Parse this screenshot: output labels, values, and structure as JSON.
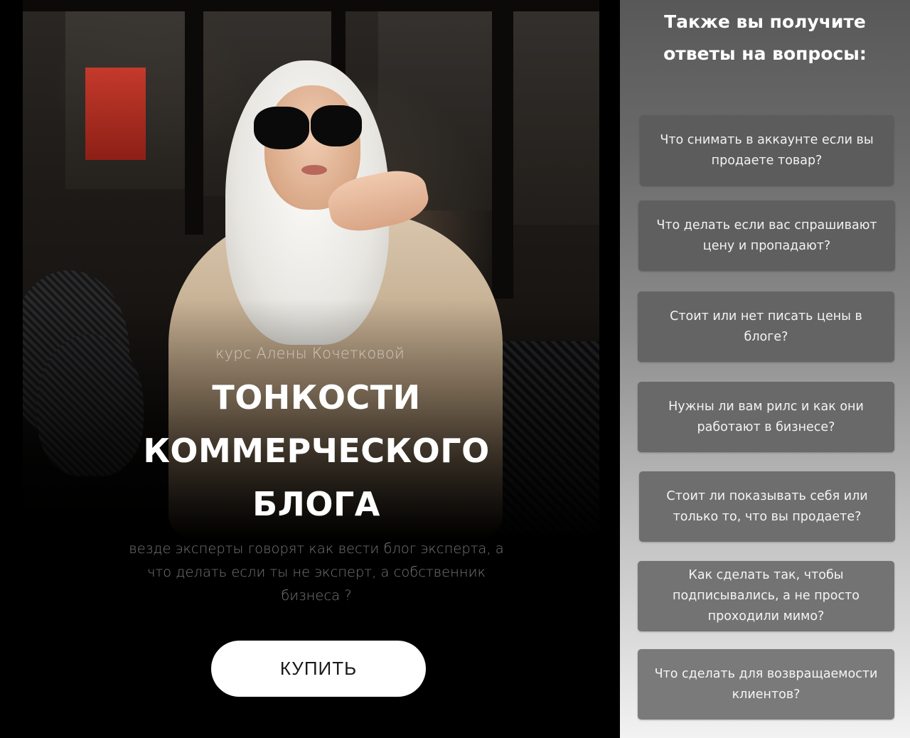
{
  "hero": {
    "subtitle": "курс Алены Кочетковой",
    "title_line1": "ТОНКОСТИ",
    "title_line2": "КОММЕРЧЕСКОГО",
    "title_line3": "БЛОГА",
    "description": "везде эксперты говорят как вести блог эксперта, а что делать если ты не эксперт, а собственник бизнеса ?",
    "buy_label": "КУПИТЬ"
  },
  "faq": {
    "heading_line1": "Также вы получите",
    "heading_line2": "ответы на вопросы:",
    "items": [
      {
        "question": "Что снимать в аккаунте если вы продаете товар?"
      },
      {
        "question": "Что делать если вас спрашивают цену и пропадают?"
      },
      {
        "question": "Стоит или нет писать цены в блоге?"
      },
      {
        "question": "Нужны ли вам рилс и как они работают в бизнесе?"
      },
      {
        "question": "Стоит ли показывать себя или только то, что вы продаете?"
      },
      {
        "question": "Как сделать так, чтобы подписывались, а не просто проходили мимо?"
      },
      {
        "question": "Что сделать для возвращаемости клиентов?"
      }
    ]
  },
  "colors": {
    "hero_background": "#000000",
    "button_background": "#ffffff",
    "faq_card": "#606060"
  }
}
